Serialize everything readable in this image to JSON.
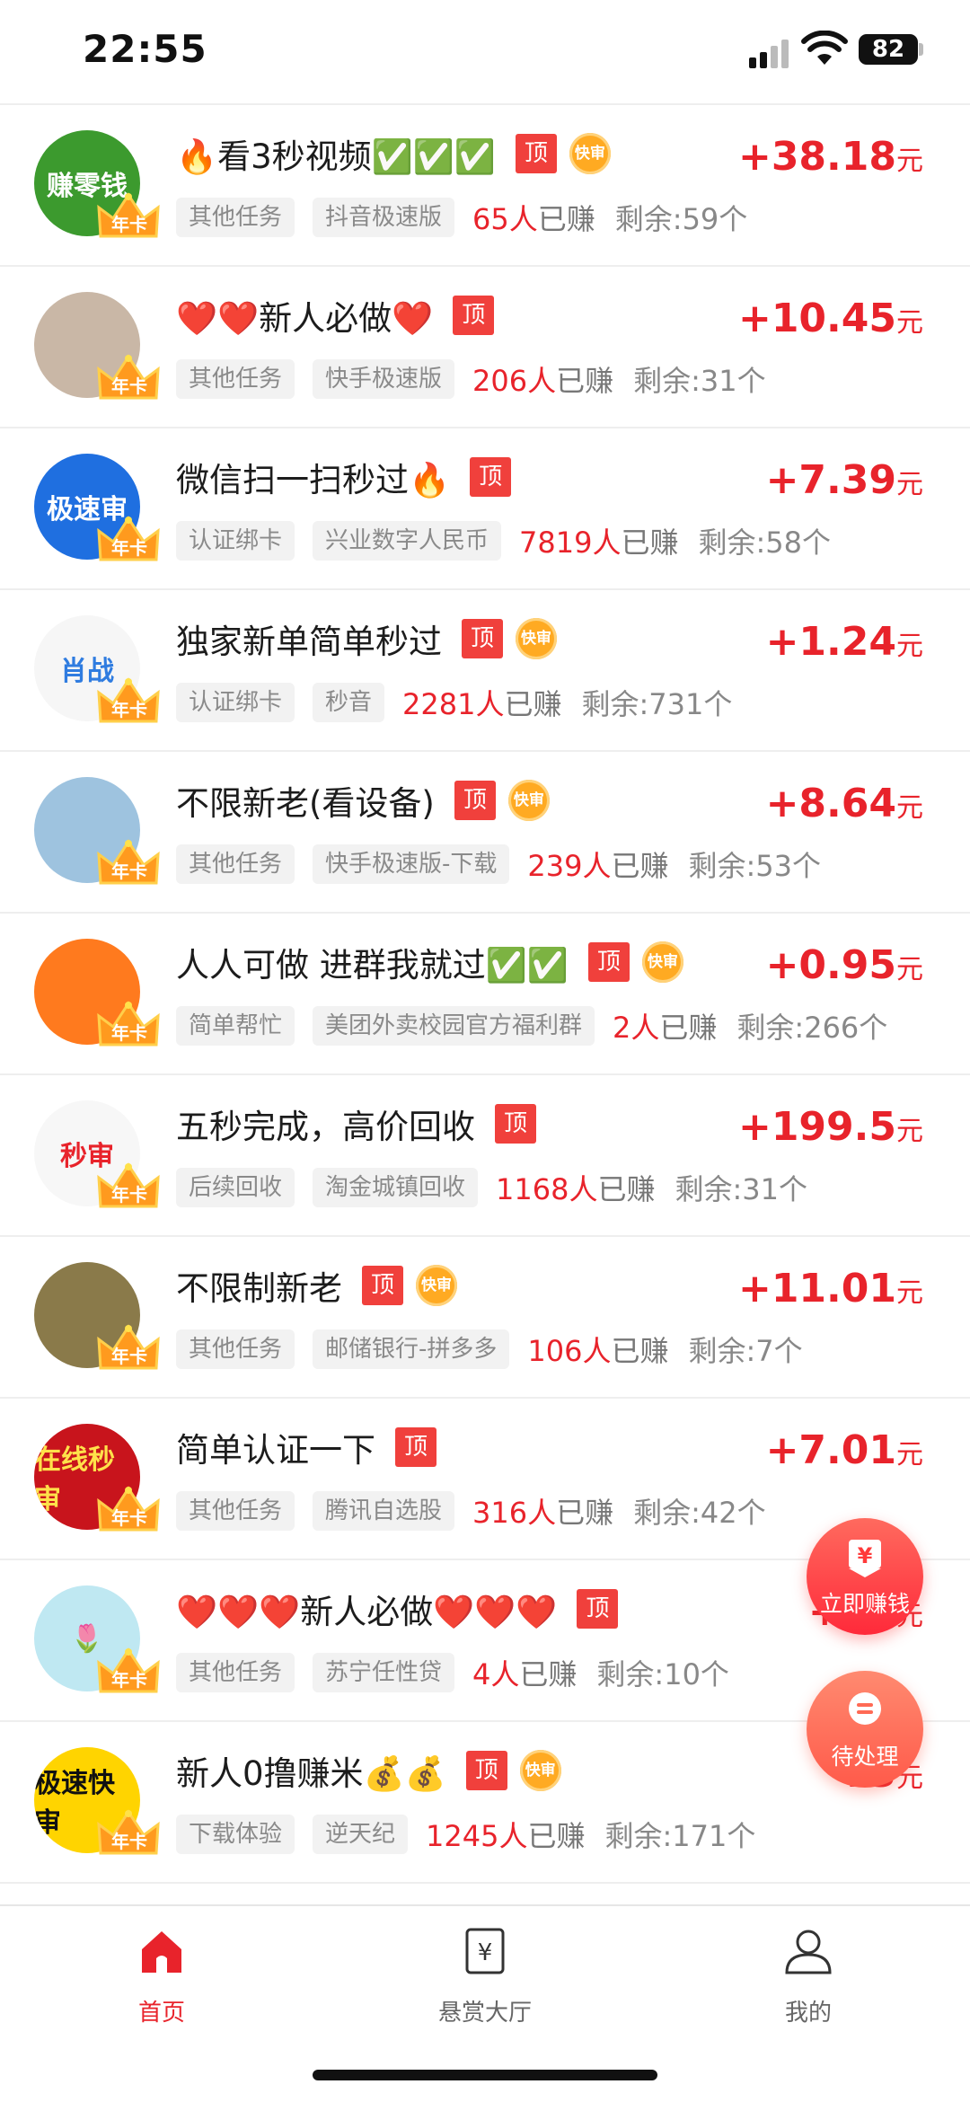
{
  "status": {
    "time": "22:55",
    "battery": "82"
  },
  "tasks": [
    {
      "title": "🔥看3秒视频✅✅✅",
      "top": true,
      "fast": true,
      "price": "+38.18",
      "tags": [
        "其他任务",
        "抖音极速版"
      ],
      "count": "65人",
      "remain": "剩余:59个",
      "avatar_text": "赚零钱",
      "avatar_bg": "#3c9a2e",
      "avatar_fg": "#ffffff"
    },
    {
      "title": "❤️❤️新人必做❤️",
      "top": true,
      "fast": false,
      "price": "+10.45",
      "tags": [
        "其他任务",
        "快手极速版"
      ],
      "count": "206人",
      "remain": "剩余:31个",
      "avatar_text": "",
      "avatar_bg": "#c9b7a6",
      "avatar_fg": "#ffffff"
    },
    {
      "title": "微信扫一扫秒过🔥",
      "top": true,
      "fast": false,
      "price": "+7.39",
      "tags": [
        "认证绑卡",
        "兴业数字人民币"
      ],
      "count": "7819人",
      "remain": "剩余:58个",
      "avatar_text": "极速审",
      "avatar_bg": "#1f6fe0",
      "avatar_fg": "#ffffff"
    },
    {
      "title": "独家新单简单秒过",
      "top": true,
      "fast": true,
      "price": "+1.24",
      "tags": [
        "认证绑卡",
        "秒音"
      ],
      "count": "2281人",
      "remain": "剩余:731个",
      "avatar_text": "肖战",
      "avatar_bg": "#f6f6f6",
      "avatar_fg": "#2f7ce0"
    },
    {
      "title": "不限新老(看设备)",
      "top": true,
      "fast": true,
      "price": "+8.64",
      "tags": [
        "其他任务",
        "快手极速版-下载"
      ],
      "count": "239人",
      "remain": "剩余:53个",
      "avatar_text": "",
      "avatar_bg": "#9ec3df",
      "avatar_fg": "#ffffff"
    },
    {
      "title": "人人可做 进群我就过✅✅",
      "top": true,
      "fast": true,
      "price": "+0.95",
      "tags": [
        "简单帮忙",
        "美团外卖校园官方福利群"
      ],
      "count": "2人",
      "remain": "剩余:266个",
      "avatar_text": "",
      "avatar_bg": "#ff7a1e",
      "avatar_fg": "#ffffff"
    },
    {
      "title": "五秒完成，高价回收",
      "top": true,
      "fast": false,
      "price": "+199.5",
      "tags": [
        "后续回收",
        "淘金城镇回收"
      ],
      "count": "1168人",
      "remain": "剩余:31个",
      "avatar_text": "秒审",
      "avatar_bg": "#f7f7f7",
      "avatar_fg": "#e8232b"
    },
    {
      "title": "不限制新老",
      "top": true,
      "fast": true,
      "price": "+11.01",
      "tags": [
        "其他任务",
        "邮储银行-拼多多"
      ],
      "count": "106人",
      "remain": "剩余:7个",
      "avatar_text": "",
      "avatar_bg": "#8a7a4a",
      "avatar_fg": "#ffffff"
    },
    {
      "title": "简单认证一下",
      "top": true,
      "fast": false,
      "price": "+7.01",
      "tags": [
        "其他任务",
        "腾讯自选股"
      ],
      "count": "316人",
      "remain": "剩余:42个",
      "avatar_text": "在线秒审",
      "avatar_bg": "#c8141c",
      "avatar_fg": "#ffe14a"
    },
    {
      "title": "❤️❤️❤️新人必做❤️❤️❤️",
      "top": true,
      "fast": false,
      "price": "+14",
      "tags": [
        "其他任务",
        "苏宁任性贷"
      ],
      "count": "4人",
      "remain": "剩余:10个",
      "avatar_text": "🌷",
      "avatar_bg": "#bfe8f2",
      "avatar_fg": "#e8232b"
    },
    {
      "title": "新人0撸赚米💰💰",
      "top": true,
      "fast": true,
      "price": "+3",
      "tags": [
        "下载体验",
        "逆天纪"
      ],
      "count": "1245人",
      "remain": "剩余:171个",
      "avatar_text": "极速快审",
      "avatar_bg": "#ffd400",
      "avatar_fg": "#111111"
    }
  ],
  "labels": {
    "top": "顶",
    "fast": "快审",
    "crown": "年卡",
    "earned": "已赚",
    "unit": "元"
  },
  "fab": {
    "earn": "立即赚钱",
    "pending": "待处理"
  },
  "tabs": [
    {
      "label": "首页",
      "active": true
    },
    {
      "label": "悬赏大厅",
      "active": false
    },
    {
      "label": "我的",
      "active": false
    }
  ],
  "colors": {
    "accent": "#e8232b",
    "tab_active": "#e8232b",
    "tab_inactive": "#666666"
  }
}
